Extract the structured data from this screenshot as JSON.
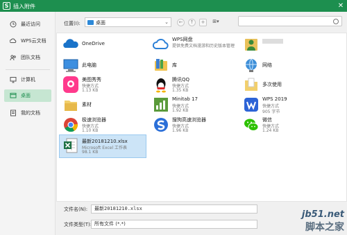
{
  "window": {
    "title": "插入附件",
    "logo_letter": "S",
    "close_glyph": "✕"
  },
  "sidebar": {
    "items": [
      {
        "label": "最近访问",
        "icon": "clock-icon"
      },
      {
        "label": "WPS云文档",
        "icon": "cloud-doc-icon"
      },
      {
        "label": "团队文档",
        "icon": "team-doc-icon"
      },
      {
        "label": "计算机",
        "icon": "computer-icon"
      },
      {
        "label": "桌面",
        "icon": "desktop-icon"
      },
      {
        "label": "我的文档",
        "icon": "my-docs-icon"
      }
    ],
    "active_index": 4
  },
  "toolbar": {
    "location_label": "位置(I):",
    "location_value": "桌面",
    "dropdown_glyph": "⌄",
    "back_glyph": "←",
    "up_glyph": "↑",
    "newfolder_glyph": "+",
    "view_glyph": "⊞▾",
    "search_placeholder": ""
  },
  "files": [
    {
      "name": "OneDrive",
      "sub": "",
      "size": "",
      "icon": "onedrive-icon"
    },
    {
      "name": "WPS网盘",
      "sub": "提供免费文档漫游和历史版本管理",
      "size": "",
      "icon": "wps-cloud-icon"
    },
    {
      "name": "",
      "sub": "",
      "size": "",
      "icon": "user-folder-icon"
    },
    {
      "name": "此电脑",
      "sub": "",
      "size": "",
      "icon": "this-pc-icon"
    },
    {
      "name": "库",
      "sub": "",
      "size": "",
      "icon": "library-icon"
    },
    {
      "name": "网络",
      "sub": "",
      "size": "",
      "icon": "network-icon"
    },
    {
      "name": "美图秀秀",
      "sub": "快捷方式",
      "size": "1.13 KB",
      "icon": "meitu-icon"
    },
    {
      "name": "腾讯QQ",
      "sub": "快捷方式",
      "size": "1.35 KB",
      "icon": "qq-icon"
    },
    {
      "name": "",
      "sub": "多次使用",
      "size": "",
      "icon": "folder-icon"
    },
    {
      "name": "素材",
      "sub": "",
      "size": "",
      "icon": "folder-icon"
    },
    {
      "name": "Minitab 17",
      "sub": "快捷方式",
      "size": "1.92 KB",
      "icon": "minitab-icon"
    },
    {
      "name": "WPS 2019",
      "sub": "快捷方式",
      "size": "905 字节",
      "icon": "wps-icon"
    },
    {
      "name": "极速浏览器",
      "sub": "快捷方式",
      "size": "1.10 KB",
      "icon": "chrome-icon"
    },
    {
      "name": "搜狗高速浏览器",
      "sub": "快捷方式",
      "size": "1.96 KB",
      "icon": "sogou-icon"
    },
    {
      "name": "微信",
      "sub": "快捷方式",
      "size": "1.24 KB",
      "icon": "wechat-icon"
    },
    {
      "name": "最新20181210.xlsx",
      "sub": "Microsoft Excel 工作表",
      "size": "98.1 KB",
      "icon": "excel-icon",
      "selected": true
    }
  ],
  "footer": {
    "filename_label": "文件名(N):",
    "filename_value": "最新20181210.xlsx",
    "filetype_label": "文件类型(T):",
    "filetype_value": "所有文件 (*.*)"
  },
  "watermark": {
    "line1": "jb51.net",
    "line2": "脚本之家"
  },
  "colors": {
    "accent": "#1d8f4f",
    "selection": "#cce4f7",
    "active_sidebar": "#c6e6d2"
  }
}
